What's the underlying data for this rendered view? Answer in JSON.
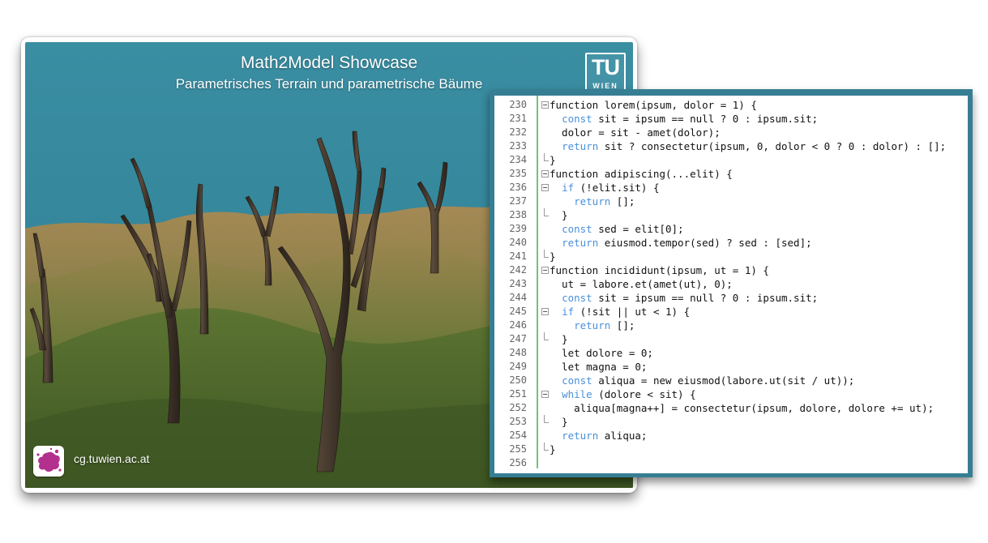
{
  "showcase": {
    "title": "Math2Model Showcase",
    "subtitle": "Parametrisches Terrain und parametrische Bäume",
    "logo_top": "TU",
    "logo_bottom": "WIEN",
    "site": "cg.tuwien.ac.at"
  },
  "colors": {
    "sky": "#3a8da1",
    "panel_border": "#367e93",
    "keyword": "#4a90d9",
    "fold_guide": "#74c27e",
    "terrain_green": "#4e6a2a",
    "terrain_sand": "#a58a55",
    "tree_bark": "#3a2f26",
    "logo_magenta": "#b3308f"
  },
  "icons": [
    "tu-wien-logo",
    "cg-splat-icon",
    "fold-minus-icon"
  ],
  "code": {
    "lines": [
      {
        "n": "230",
        "fold": "start",
        "parts": [
          [
            "t",
            "function lorem(ipsum, dolor = 1) {"
          ]
        ]
      },
      {
        "n": "231",
        "fold": "",
        "parts": [
          [
            "t",
            "  "
          ],
          [
            "k",
            "const"
          ],
          [
            "t",
            " sit = ipsum == null ? 0 : ipsum.sit;"
          ]
        ]
      },
      {
        "n": "232",
        "fold": "",
        "parts": [
          [
            "t",
            "  dolor = sit - amet(dolor);"
          ]
        ]
      },
      {
        "n": "233",
        "fold": "",
        "parts": [
          [
            "t",
            "  "
          ],
          [
            "k",
            "return"
          ],
          [
            "t",
            " sit ? consectetur(ipsum, 0, dolor < 0 ? 0 : dolor) : [];"
          ]
        ]
      },
      {
        "n": "234",
        "fold": "end",
        "parts": [
          [
            "t",
            "}"
          ]
        ]
      },
      {
        "n": "235",
        "fold": "start",
        "parts": [
          [
            "t",
            "function adipiscing(...elit) {"
          ]
        ]
      },
      {
        "n": "236",
        "fold": "start",
        "parts": [
          [
            "t",
            "  "
          ],
          [
            "k",
            "if"
          ],
          [
            "t",
            " (!elit.sit) {"
          ]
        ]
      },
      {
        "n": "237",
        "fold": "",
        "parts": [
          [
            "t",
            "    "
          ],
          [
            "k",
            "return"
          ],
          [
            "t",
            " [];"
          ]
        ]
      },
      {
        "n": "238",
        "fold": "end",
        "parts": [
          [
            "t",
            "  }"
          ]
        ]
      },
      {
        "n": "239",
        "fold": "",
        "parts": [
          [
            "t",
            "  "
          ],
          [
            "k",
            "const"
          ],
          [
            "t",
            " sed = elit[0];"
          ]
        ]
      },
      {
        "n": "240",
        "fold": "",
        "parts": [
          [
            "t",
            "  "
          ],
          [
            "k",
            "return"
          ],
          [
            "t",
            " eiusmod.tempor(sed) ? sed : [sed];"
          ]
        ]
      },
      {
        "n": "241",
        "fold": "end",
        "parts": [
          [
            "t",
            "}"
          ]
        ]
      },
      {
        "n": "242",
        "fold": "start",
        "parts": [
          [
            "t",
            "function incididunt(ipsum, ut = 1) {"
          ]
        ]
      },
      {
        "n": "243",
        "fold": "",
        "parts": [
          [
            "t",
            "  ut = labore.et(amet(ut), 0);"
          ]
        ]
      },
      {
        "n": "244",
        "fold": "",
        "parts": [
          [
            "t",
            "  "
          ],
          [
            "k",
            "const"
          ],
          [
            "t",
            " sit = ipsum == null ? 0 : ipsum.sit;"
          ]
        ]
      },
      {
        "n": "245",
        "fold": "start",
        "parts": [
          [
            "t",
            "  "
          ],
          [
            "k",
            "if"
          ],
          [
            "t",
            " (!sit || ut < 1) {"
          ]
        ]
      },
      {
        "n": "246",
        "fold": "",
        "parts": [
          [
            "t",
            "    "
          ],
          [
            "k",
            "return"
          ],
          [
            "t",
            " [];"
          ]
        ]
      },
      {
        "n": "247",
        "fold": "end",
        "parts": [
          [
            "t",
            "  }"
          ]
        ]
      },
      {
        "n": "248",
        "fold": "",
        "parts": [
          [
            "t",
            "  let dolore = 0;"
          ]
        ]
      },
      {
        "n": "249",
        "fold": "",
        "parts": [
          [
            "t",
            "  let magna = 0;"
          ]
        ]
      },
      {
        "n": "250",
        "fold": "",
        "parts": [
          [
            "t",
            "  "
          ],
          [
            "k",
            "const"
          ],
          [
            "t",
            " aliqua = new eiusmod(labore.ut(sit / ut));"
          ]
        ]
      },
      {
        "n": "251",
        "fold": "start",
        "parts": [
          [
            "t",
            "  "
          ],
          [
            "k",
            "while"
          ],
          [
            "t",
            " (dolore < sit) {"
          ]
        ]
      },
      {
        "n": "252",
        "fold": "",
        "parts": [
          [
            "t",
            "    aliqua[magna++] = consectetur(ipsum, dolore, dolore += ut);"
          ]
        ]
      },
      {
        "n": "253",
        "fold": "end",
        "parts": [
          [
            "t",
            "  }"
          ]
        ]
      },
      {
        "n": "254",
        "fold": "",
        "parts": [
          [
            "t",
            "  "
          ],
          [
            "k",
            "return"
          ],
          [
            "t",
            " aliqua;"
          ]
        ]
      },
      {
        "n": "255",
        "fold": "end",
        "parts": [
          [
            "t",
            "}"
          ]
        ]
      },
      {
        "n": "256",
        "fold": "",
        "parts": [
          [
            "t",
            ""
          ]
        ]
      }
    ]
  }
}
